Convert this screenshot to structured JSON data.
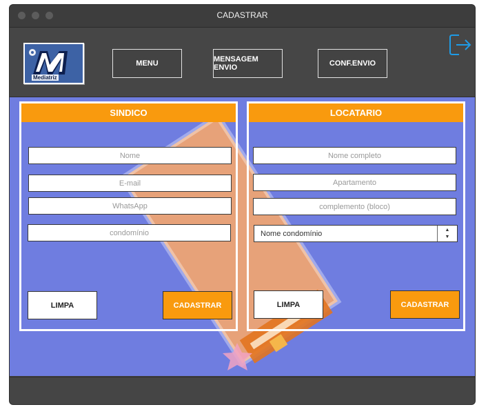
{
  "window": {
    "title": "CADASTRAR"
  },
  "logo": {
    "text": "Mediatriz"
  },
  "nav": {
    "menu_label": "MENU",
    "mensagem_label": "MENSAGEM ENVIO",
    "conf_label": "CONF.ENVIO"
  },
  "exit_icon": {
    "name": "logout-icon",
    "color": "#1e9be6"
  },
  "sindico": {
    "title": "SINDICO",
    "nome_placeholder": "Nome",
    "email_placeholder": "E-mail",
    "whatsapp_placeholder": "WhatsApp",
    "condominio_placeholder": "condomínio",
    "limpa_label": "LIMPA",
    "cadastrar_label": "CADASTRAR"
  },
  "locatario": {
    "title": "LOCATARIO",
    "nome_placeholder": "Nome completo",
    "apartamento_placeholder": "Apartamento",
    "complemento_placeholder": "complemento (bloco)",
    "condominio_select_value": "Nome condomínio",
    "limpa_label": "LIMPA",
    "cadastrar_label": "CADASTRAR"
  },
  "colors": {
    "accent_orange": "#f99a0e",
    "content_bg": "#6f7de0",
    "chrome_dark": "#444444"
  }
}
